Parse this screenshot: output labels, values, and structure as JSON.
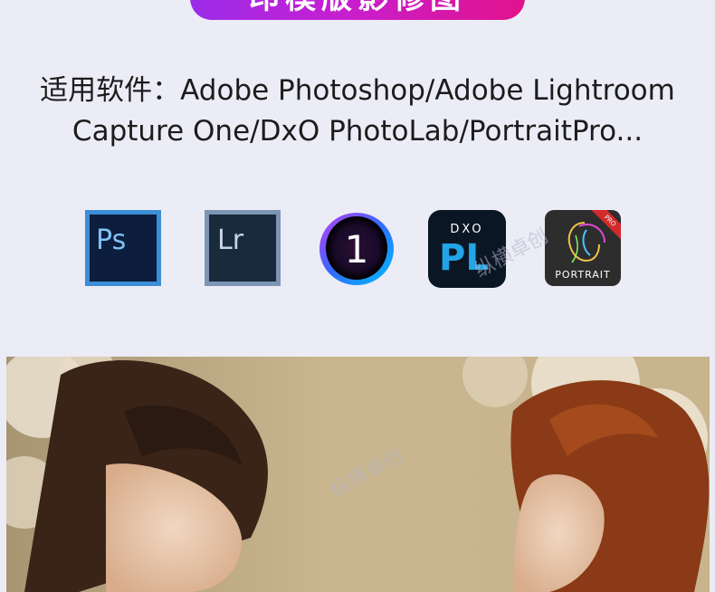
{
  "header": {
    "title": "印模版影修图"
  },
  "software": {
    "line1": "适用软件：Adobe Photoshop/Adobe Lightroom",
    "line2": "Capture One/DxO PhotoLab/PortraitPro..."
  },
  "icons": {
    "ps_text": "Ps",
    "lr_text": "Lr",
    "capture_one_text": "1",
    "dxo_brand": "DXO",
    "dxo_text": "PL",
    "portrait_label": "PORTRAIT",
    "portrait_badge": "PRO"
  },
  "watermark": {
    "text": "纵横卓创"
  },
  "colors": {
    "background": "#ececf7",
    "title_gradient_start": "#9b2ce9",
    "title_gradient_end": "#e2128c"
  }
}
